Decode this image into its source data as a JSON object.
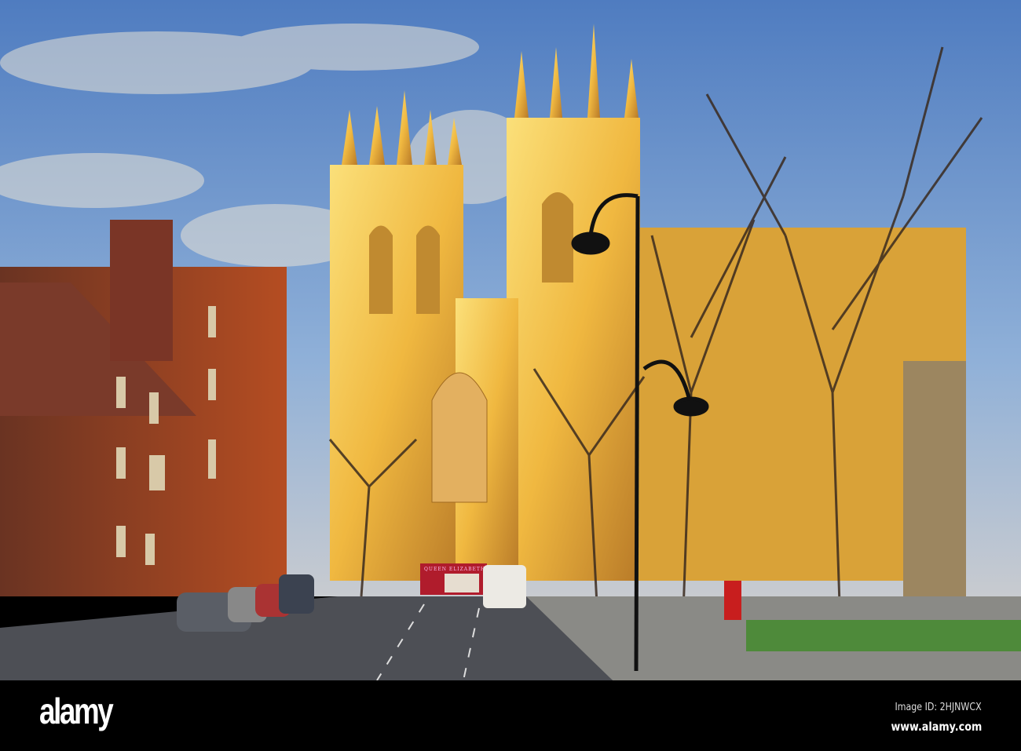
{
  "photo": {
    "sign_text": "QUEEN ELIZABETH SQUARE",
    "colors": {
      "sky": "#5b86c4",
      "stone": "#f2c24a",
      "brick": "#8a3e22",
      "road": "#4d4f55"
    }
  },
  "watermark": {
    "logo": "alamy",
    "image_id": "Image ID: 2HJNWCX",
    "website": "www.alamy.com"
  }
}
